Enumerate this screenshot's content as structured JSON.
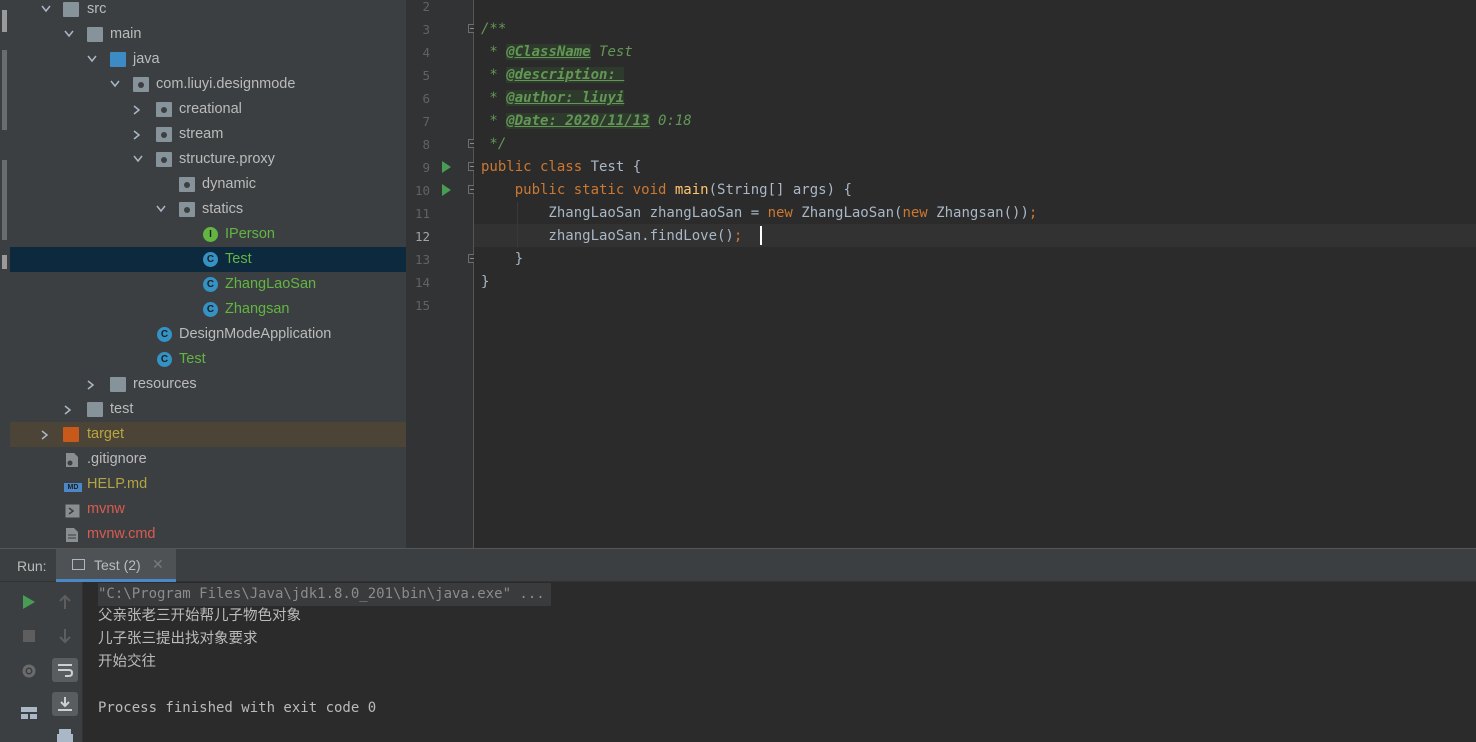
{
  "project_tree": {
    "rows": [
      {
        "label": "src"
      },
      {
        "label": "main"
      },
      {
        "label": "java"
      },
      {
        "label": "com.liuyi.designmode"
      },
      {
        "label": "creational"
      },
      {
        "label": "stream"
      },
      {
        "label": "structure.proxy"
      },
      {
        "label": "dynamic"
      },
      {
        "label": "statics"
      },
      {
        "label": "IPerson"
      },
      {
        "label": "Test"
      },
      {
        "label": "ZhangLaoSan"
      },
      {
        "label": "Zhangsan"
      },
      {
        "label": "DesignModeApplication"
      },
      {
        "label": "Test"
      },
      {
        "label": "resources"
      },
      {
        "label": "test"
      },
      {
        "label": "target"
      },
      {
        "label": ".gitignore"
      },
      {
        "label": "HELP.md"
      },
      {
        "label": "mvnw"
      },
      {
        "label": "mvnw.cmd"
      }
    ],
    "icon_badges": {
      "class": "C",
      "interface": "I",
      "markdown": "MD"
    }
  },
  "editor": {
    "line_numbers": [
      "2",
      "3",
      "4",
      "5",
      "6",
      "7",
      "8",
      "9",
      "10",
      "11",
      "12",
      "13",
      "14",
      "15"
    ],
    "lines": [
      {
        "parts": []
      },
      {
        "parts": [
          {
            "t": "/**",
            "c": "cm"
          }
        ]
      },
      {
        "parts": [
          {
            "t": " * ",
            "c": "cm"
          },
          {
            "t": "@ClassName",
            "c": "tag"
          },
          {
            "t": " Test",
            "c": "cm"
          }
        ]
      },
      {
        "parts": [
          {
            "t": " * ",
            "c": "cm"
          },
          {
            "t": "@description: ",
            "c": "tag"
          }
        ]
      },
      {
        "parts": [
          {
            "t": " * ",
            "c": "cm"
          },
          {
            "t": "@author: liuyi",
            "c": "tag"
          }
        ]
      },
      {
        "parts": [
          {
            "t": " * ",
            "c": "cm"
          },
          {
            "t": "@Date: 2020/11/13",
            "c": "tag"
          },
          {
            "t": " 0:18",
            "c": "cm"
          }
        ]
      },
      {
        "parts": [
          {
            "t": " */",
            "c": "cm"
          }
        ]
      },
      {
        "parts": [
          {
            "t": "public class ",
            "c": "k"
          },
          {
            "t": "Test {",
            "c": ""
          }
        ]
      },
      {
        "parts": [
          {
            "t": "    public static void ",
            "c": "k"
          },
          {
            "t": "main",
            "c": "fn"
          },
          {
            "t": "(String[] args) {",
            "c": ""
          }
        ]
      },
      {
        "parts": [
          {
            "t": "        ZhangLaoSan zhangLaoSan = ",
            "c": ""
          },
          {
            "t": "new ",
            "c": "k"
          },
          {
            "t": "ZhangLaoSan(",
            "c": ""
          },
          {
            "t": "new ",
            "c": "k"
          },
          {
            "t": "Zhangsan())",
            "c": ""
          },
          {
            "t": ";",
            "c": "k"
          }
        ]
      },
      {
        "parts": [
          {
            "t": "        zhangLaoSan.findLove()",
            "c": ""
          },
          {
            "t": ";",
            "c": "k"
          }
        ]
      },
      {
        "parts": [
          {
            "t": "    }",
            "c": ""
          }
        ]
      },
      {
        "parts": [
          {
            "t": "}",
            "c": ""
          }
        ]
      },
      {
        "parts": []
      }
    ]
  },
  "run_panel": {
    "title": "Run:",
    "tab_label": "Test (2)",
    "tab_close": "✕",
    "console_lines": [
      "\"C:\\Program Files\\Java\\jdk1.8.0_201\\bin\\java.exe\" ...",
      "父亲张老三开始帮儿子物色对象",
      "儿子张三提出找对象要求",
      "开始交往",
      "",
      "Process finished with exit code 0"
    ]
  },
  "colors": {
    "keyword": "#cc7832",
    "function": "#ffc66d",
    "comment": "#629755",
    "text": "#a9b7c6",
    "selection": "#0d293e",
    "accent_tab": "#4a88c7",
    "run_green": "#499c54"
  }
}
